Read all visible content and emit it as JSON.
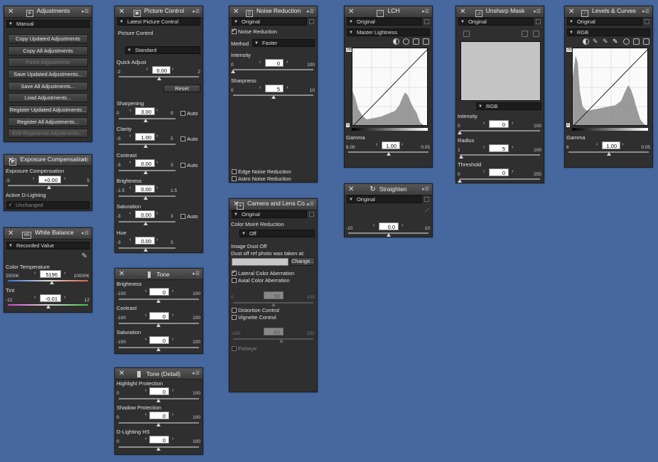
{
  "adjustments": {
    "title": "Adjustments",
    "mode": "Manual",
    "buttons": [
      "Copy Updated Adjustments",
      "Copy All Adjustments",
      "Paste Adjustments",
      "Save Updated Adjustments...",
      "Save All Adjustments...",
      "Load Adjustments...",
      "Register Updated Adjustments...",
      "Register All Adjustments...",
      "Edit Registered Adjustments..."
    ]
  },
  "exposure": {
    "title": "Exposure Compensation",
    "label": "Exposure Compensation",
    "value": "+0.00",
    "min": "-5",
    "max": "5",
    "adl_label": "Active D-Lighting",
    "adl_value": "Unchanged"
  },
  "wb": {
    "title": "White Balance",
    "icon_text": "WB",
    "mode": "Recorded Value",
    "temp_label": "Color Temperature",
    "temp_value": "5196",
    "temp_min": "2500K",
    "temp_max": "10000K",
    "tint_label": "Tint",
    "tint_value": "-0.01",
    "tint_min": "-12",
    "tint_max": "12"
  },
  "picture": {
    "title": "Picture Control",
    "preset": "Latest Picture Control",
    "section": "Picture Control",
    "style": "Standard",
    "quick_label": "Quick Adjust",
    "quick_value": "0.00",
    "quick_min": "-2",
    "quick_max": "2",
    "reset": "Reset",
    "auto": "Auto",
    "params": [
      {
        "label": "Sharpening",
        "value": "3.00",
        "min": "0",
        "max": "9",
        "auto": true
      },
      {
        "label": "Clarity",
        "value": "1.00",
        "min": "-5",
        "max": "5",
        "auto": true
      },
      {
        "label": "Contrast",
        "value": "0.00",
        "min": "-3",
        "max": "3",
        "auto": true
      },
      {
        "label": "Brightness",
        "value": "0.00",
        "min": "-1.5",
        "max": "1.5",
        "auto": false
      },
      {
        "label": "Saturation",
        "value": "0.00",
        "min": "-3",
        "max": "3",
        "auto": true
      },
      {
        "label": "Hue",
        "value": "0.00",
        "min": "-3",
        "max": "3",
        "auto": false
      }
    ]
  },
  "tone": {
    "title": "Tone",
    "params": [
      {
        "label": "Brightness",
        "value": "0",
        "min": "-100",
        "max": "100"
      },
      {
        "label": "Contrast",
        "value": "0",
        "min": "-100",
        "max": "100"
      },
      {
        "label": "Saturation",
        "value": "0",
        "min": "-100",
        "max": "100"
      }
    ]
  },
  "tone_detail": {
    "title": "Tone (Detail)",
    "params": [
      {
        "label": "Highlight Protection",
        "value": "0",
        "min": "0",
        "max": "100"
      },
      {
        "label": "Shadow Protection",
        "value": "0",
        "min": "0",
        "max": "100"
      },
      {
        "label": "D-Lighting HS",
        "value": "0",
        "min": "0",
        "max": "100"
      }
    ]
  },
  "noise": {
    "title": "Noise Reduction",
    "preset": "Original",
    "nr_label": "Noise Reduction",
    "method_label": "Method",
    "method_value": "Faster",
    "intensity_label": "Intensity",
    "intensity_value": "0",
    "intensity_min": "0",
    "intensity_max": "100",
    "sharp_label": "Sharpness",
    "sharp_value": "5",
    "sharp_min": "0",
    "sharp_max": "10",
    "edge": "Edge Noise Reduction",
    "astro": "Astro Noise Reduction"
  },
  "camera": {
    "title": "Camera and Lens Co...",
    "preset": "Original",
    "moire_label": "Color Moiré Reduction",
    "moire_value": "Off",
    "dust_label": "Image Dust Off",
    "dust_sub": "Dust off ref photo was taken at:",
    "change": "Change...",
    "lat": "Lateral Color Aberration",
    "axial": "Axial Color Aberration",
    "axial_value": "50",
    "axial_min": "0",
    "axial_max": "100",
    "dist": "Distortion Control",
    "vig": "Vignette Control",
    "vig_value": "60",
    "vig_min": "-100",
    "vig_max": "200",
    "fisheye": "Fisheye"
  },
  "lch": {
    "title": "LCH",
    "preset": "Original",
    "channel": "Master Lightness",
    "top": "255",
    "bottom": "0",
    "gamma_label": "Gamma",
    "gamma_value": "1.00",
    "gamma_min": "6.00",
    "gamma_max": "0.05"
  },
  "straighten": {
    "title": "Straighten",
    "preset": "Original",
    "value": "0.0",
    "min": "-10",
    "max": "10"
  },
  "unsharp": {
    "title": "Unsharp Mask",
    "preset": "Original",
    "channel": "RGB",
    "intensity_label": "Intensity",
    "intensity_value": "0",
    "intensity_min": "0",
    "intensity_max": "100",
    "radius_label": "Radius",
    "radius_value": "5",
    "radius_min": "1",
    "radius_max": "100",
    "threshold_label": "Threshold",
    "threshold_value": "0",
    "threshold_min": "0",
    "threshold_max": "255"
  },
  "levels": {
    "title": "Levels & Curves",
    "preset": "Original",
    "channel": "RGB",
    "top": "255",
    "bottom": "0",
    "gamma_label": "Gamma",
    "gamma_value": "1.00",
    "gamma_min": "6",
    "gamma_max": "0.05"
  }
}
